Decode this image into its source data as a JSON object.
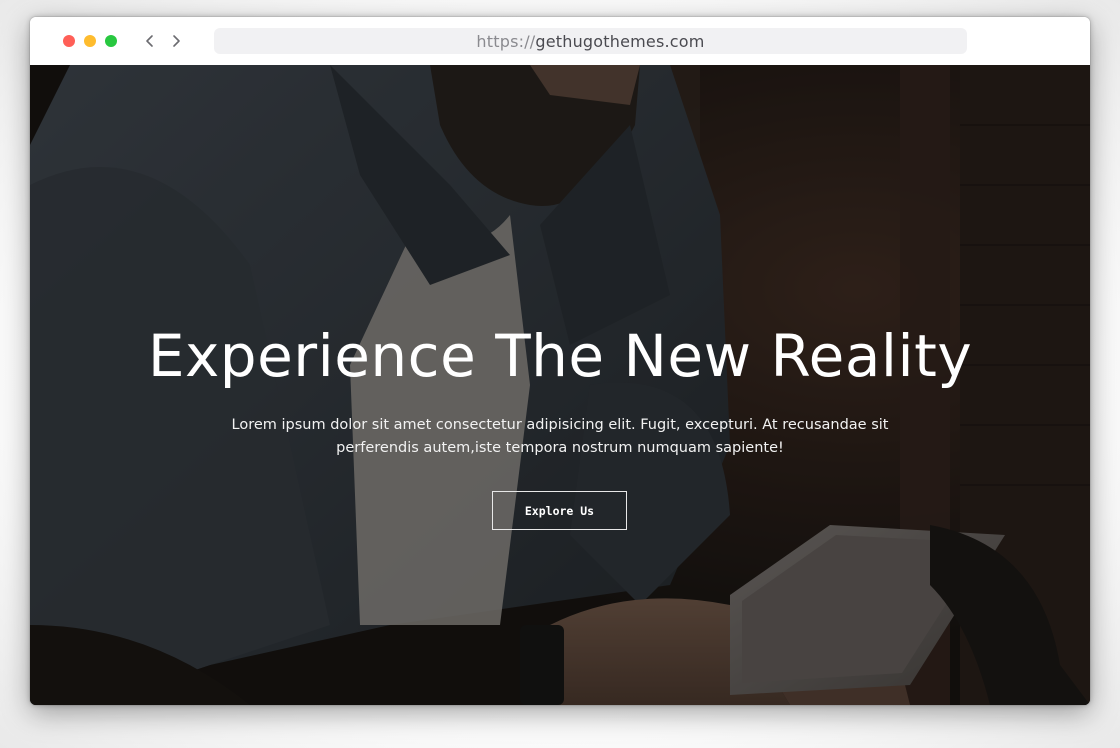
{
  "browser": {
    "traffic_lights": {
      "close_color": "#ff5f57",
      "minimize_color": "#febc2e",
      "maximize_color": "#28c840"
    },
    "back_icon": "chevron-left-icon",
    "forward_icon": "chevron-right-icon",
    "url": {
      "scheme": "https://",
      "host": "gethugothemes.com"
    }
  },
  "hero": {
    "background_image": "man-with-tablet-photo",
    "title": "Experience The New Reality",
    "subtitle": "Lorem ipsum dolor sit amet consectetur adipisicing elit. Fugit, excepturi. At recusandae sit perferendis autem,iste tempora nostrum numquam sapiente!",
    "cta_label": "Explore Us"
  },
  "colors": {
    "hero_overlay": "#0c0a09",
    "text_primary": "#ffffff"
  }
}
